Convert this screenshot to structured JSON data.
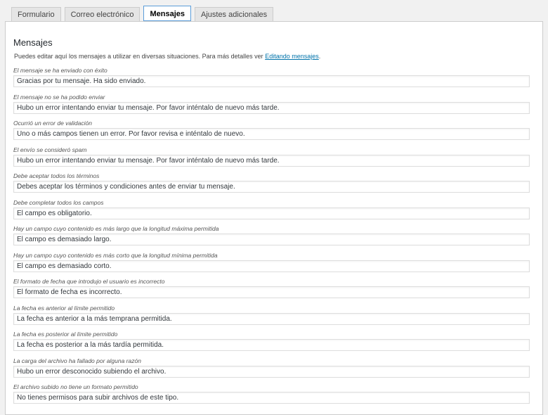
{
  "tabs": [
    {
      "label": "Formulario",
      "active": false
    },
    {
      "label": "Correo electrónico",
      "active": false
    },
    {
      "label": "Mensajes",
      "active": true
    },
    {
      "label": "Ajustes adicionales",
      "active": false
    }
  ],
  "panel": {
    "title": "Mensajes",
    "intro_text": "Puedes editar aquí los mensajes a utilizar en diversas situaciones. Para más detalles ver ",
    "intro_link": "Editando mensajes",
    "intro_end": "."
  },
  "messages": [
    {
      "label": "El mensaje se ha enviado con éxito",
      "value": "Gracias por tu mensaje. Ha sido enviado."
    },
    {
      "label": "El mensaje no se ha podido enviar",
      "value": "Hubo un error intentando enviar tu mensaje. Por favor inténtalo de nuevo más tarde."
    },
    {
      "label": "Ocurrió un error de validación",
      "value": "Uno o más campos tienen un error. Por favor revisa e inténtalo de nuevo."
    },
    {
      "label": "El envío se consideró spam",
      "value": "Hubo un error intentando enviar tu mensaje. Por favor inténtalo de nuevo más tarde."
    },
    {
      "label": "Debe aceptar todos los términos",
      "value": "Debes aceptar los términos y condiciones antes de enviar tu mensaje."
    },
    {
      "label": "Debe completar todos los campos",
      "value": "El campo es obligatorio."
    },
    {
      "label": "Hay un campo cuyo contenido es más largo que la longitud máxima permitida",
      "value": "El campo es demasiado largo."
    },
    {
      "label": "Hay un campo cuyo contenido es más corto que la longitud mínima permitida",
      "value": "El campo es demasiado corto."
    },
    {
      "label": "El formato de fecha que introdujo el usuario es incorrecto",
      "value": "El formato de fecha es incorrecto."
    },
    {
      "label": "La fecha es anterior al límite permitido",
      "value": "La fecha es anterior a la más temprana permitida."
    },
    {
      "label": "La fecha es posterior al límite permitido",
      "value": "La fecha es posterior a la más tardía permitida."
    },
    {
      "label": "La carga del archivo ha fallado por alguna razón",
      "value": "Hubo un error desconocido subiendo el archivo."
    },
    {
      "label": "El archivo subido no tiene un formato permitido",
      "value": "No tienes permisos para subir archivos de este tipo."
    }
  ]
}
